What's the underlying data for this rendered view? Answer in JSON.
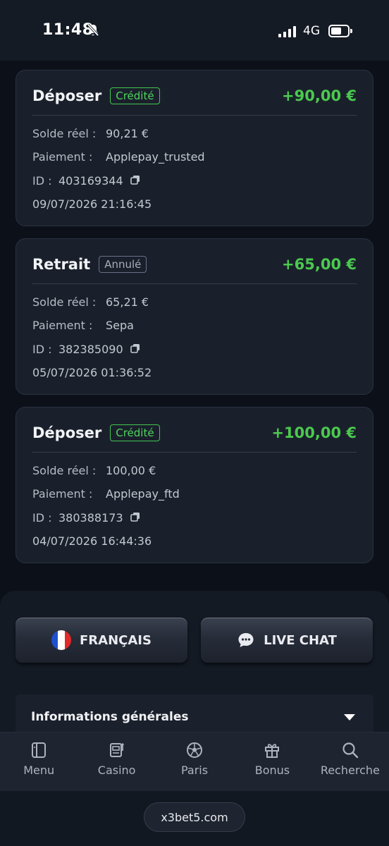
{
  "status_bar": {
    "time": "11:48",
    "network": "4G"
  },
  "transactions": [
    {
      "type": "Déposer",
      "badge": "Crédité",
      "badge_kind": "ok",
      "amount": "+90,00 €",
      "balance_label": "Solde réel :",
      "balance": "90,21 €",
      "payment_label": "Paiement :",
      "payment": "Applepay_trusted",
      "id_label": "ID :",
      "id": "403169344",
      "datetime": "09/07/2026 21:16:45"
    },
    {
      "type": "Retrait",
      "badge": "Annulé",
      "badge_kind": "cancel",
      "amount": "+65,00 €",
      "balance_label": "Solde réel :",
      "balance": "65,21 €",
      "payment_label": "Paiement :",
      "payment": "Sepa",
      "id_label": "ID :",
      "id": "382385090",
      "datetime": "05/07/2026 01:36:52"
    },
    {
      "type": "Déposer",
      "badge": "Crédité",
      "badge_kind": "ok",
      "amount": "+100,00 €",
      "balance_label": "Solde réel :",
      "balance": "100,00 €",
      "payment_label": "Paiement :",
      "payment": "Applepay_ftd",
      "id_label": "ID :",
      "id": "380388173",
      "datetime": "04/07/2026 16:44:36"
    }
  ],
  "footer": {
    "language_label": "FRANÇAIS",
    "chat_label": "LIVE CHAT",
    "info_title": "Informations générales"
  },
  "bottom_nav": [
    {
      "label": "Menu",
      "icon": "menu-icon"
    },
    {
      "label": "Casino",
      "icon": "slot-machine-icon"
    },
    {
      "label": "Paris",
      "icon": "football-icon"
    },
    {
      "label": "Bonus",
      "icon": "gift-icon"
    },
    {
      "label": "Recherche",
      "icon": "search-icon"
    }
  ],
  "url": "x3bet5.com",
  "colors": {
    "credit_green": "#4bc94f",
    "background": "#0c1119",
    "card": "#1a202b"
  }
}
